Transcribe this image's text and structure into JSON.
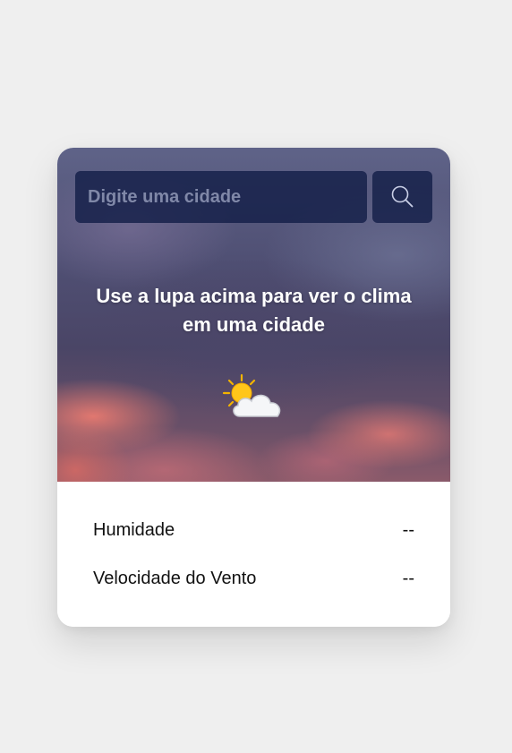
{
  "search": {
    "placeholder": "Digite uma cidade",
    "value": ""
  },
  "icons": {
    "search_button": "search-icon",
    "weather": "sun-behind-cloud-icon"
  },
  "message": "Use a lupa acima para ver o clima em uma cidade",
  "details": [
    {
      "label": "Humidade",
      "value": "--"
    },
    {
      "label": "Velocidade do Vento",
      "value": "--"
    }
  ],
  "colors": {
    "page_background": "#efefef",
    "search_background": "#141e48",
    "message_text": "#ffffff",
    "detail_text": "#111111"
  }
}
